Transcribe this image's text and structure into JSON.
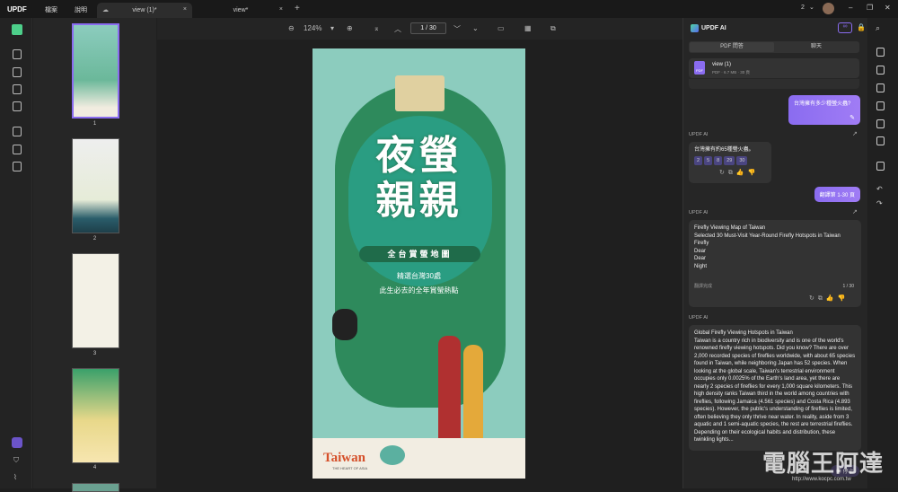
{
  "app": {
    "logo": "UPDF"
  },
  "menu": {
    "file": "檔案",
    "help": "說明"
  },
  "tabs": [
    {
      "label": "view (1)*",
      "close": "×"
    },
    {
      "label": "view*",
      "close": "×"
    }
  ],
  "new_tab": "+",
  "window": {
    "count": "2",
    "count_chevron": "⌄",
    "minimize": "–",
    "restore": "❐",
    "close": "✕"
  },
  "toolbar": {
    "zoom_out": "⊖",
    "zoom": "124%",
    "zoom_chevron": "▾",
    "zoom_in": "⊕",
    "first": "⌅",
    "prev": "︿",
    "page": "1 / 30",
    "next": "﹀",
    "last": "⌄",
    "present": "▭",
    "layout": "▦",
    "compare": "⧉"
  },
  "thumbnails": [
    {
      "number": "1",
      "selected": true
    },
    {
      "number": "2"
    },
    {
      "number": "3"
    },
    {
      "number": "4"
    }
  ],
  "poster": {
    "title_line1": "夜螢",
    "title_line2": "親親",
    "banner": "全台賞螢地圖",
    "sub1": "精選台灣30處",
    "sub2": "此生必去的全年賞螢熱點",
    "brand": "Taiwan",
    "tag": "THE HEART OF ASIA"
  },
  "ai": {
    "title": "UPDF AI",
    "seg_pdf": "PDF 問答",
    "seg_chat": "聊天",
    "file_name": "view (1)",
    "file_meta": "PDF · 6.7 MB · 30 頁",
    "file_icon": "PDF",
    "user_q1": "台灣擁有多少種螢火蟲?",
    "label1": "UPDF AI",
    "answer1": "台灣擁有約65種螢火蟲。",
    "chips": [
      "2",
      "5",
      "8",
      "29",
      "30"
    ],
    "user_q2": "翻譯第 1-30 頁",
    "label2": "UPDF AI",
    "answer2": [
      "Firefly Viewing Map of Taiwan",
      "Selected 30 Must-Visit Year-Round Firefly Hotspots in Taiwan",
      "Firefly",
      "Dear",
      "Dear",
      "Night"
    ],
    "answer2_footer_left": "翻譯完成",
    "answer2_footer_right": "1 / 30",
    "label3": "UPDF AI",
    "answer3": "Global Firefly Viewing Hotspots in Taiwan\nTaiwan is a country rich in biodiversity and is one of the world's renowned firefly viewing hotspots. Did you know? There are over 2,000 recorded species of fireflies worldwide, with about 65 species found in Taiwan, while neighboring Japan has 52 species. When looking at the global scale, Taiwan's terrestrial environment occupies only 0.0025% of the Earth's land area, yet there are nearly 2 species of fireflies for every 1,000 square kilometers. This high density ranks Taiwan third in the world among countries with fireflies, following Jamaica (4.561 species) and Costa Rica (4.893 species). However, the public's understanding of fireflies is limited, often believing they only thrive near water. In reality, aside from 3 aquatic and 1 semi-aquatic species, the rest are terrestrial fireflies. Depending on their ecological habits and distribution, these twinkling lights...",
    "stop": "停止",
    "actions": "↻⧉👍👎"
  },
  "watermark": {
    "text": "電腦王阿達",
    "url": "http://www.kocpc.com.tw"
  },
  "colors": {
    "accent": "#8a6cf0",
    "background": "#1f1f1f",
    "panel": "#262626"
  }
}
